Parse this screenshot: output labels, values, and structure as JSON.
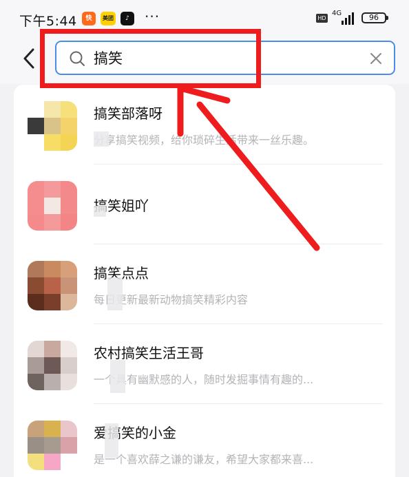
{
  "status_bar": {
    "time": "下午5:44",
    "app_icons": [
      {
        "name": "kuaishou",
        "glyph": "快"
      },
      {
        "name": "meituan",
        "glyph": "美团"
      },
      {
        "name": "tiktok",
        "glyph": "♪"
      }
    ],
    "more": "···",
    "hd": "HD",
    "network": "4G",
    "battery": "96"
  },
  "search": {
    "value": "搞笑",
    "placeholder": ""
  },
  "results": [
    {
      "title": "搞笑部落呀",
      "description": "分享搞笑视频，给你琐碎生活带来一丝乐趣。",
      "avatar_colors": [
        "#ffffff",
        "#f5e7a9",
        "#f6e07c",
        "#3a3a3a",
        "#d9c389",
        "#f3d36a",
        "#ffffff",
        "#f7dc66",
        "#f4d455"
      ]
    },
    {
      "title": "搞笑姐吖",
      "description": "",
      "avatar_colors": [
        "#f58d8f",
        "#f59a9c",
        "#f4898b",
        "#f58d8f",
        "#f3e9e2",
        "#f4898b",
        "#f58a8c",
        "#f49a9b",
        "#f38587"
      ]
    },
    {
      "title": "搞笑点点",
      "description": "每日更新最新动物搞笑精彩内容",
      "avatar_colors": [
        "#b07a5a",
        "#c98a5f",
        "#d7a07a",
        "#8a4b33",
        "#b8624a",
        "#c99378",
        "#5c2d1c",
        "#7a3f2b",
        "#dcb79c"
      ]
    },
    {
      "title": "农村搞笑生活王哥",
      "description": "一个具有幽默感的人，随时发掘事情有趣的...",
      "avatar_colors": [
        "#e2d7d2",
        "#c9a8a0",
        "#f0e9e6",
        "#a99c98",
        "#6d5a56",
        "#d8cfcc",
        "#6f6360",
        "#b9afac",
        "#e7e0dd"
      ]
    },
    {
      "title": "爱搞笑的小金",
      "description": "是一个喜欢薛之谦的谦友，希望大家都来喜...",
      "avatar_colors": [
        "#c7a27a",
        "#d7b24e",
        "#e8c6c9",
        "#9a8f86",
        "#a79a8f",
        "#d9a2a8",
        "#f3df7e",
        "#f6a7c6",
        "#ffffff"
      ]
    }
  ],
  "colors": {
    "accent": "#4a8de8",
    "annotation": "#ee1c1c"
  },
  "icons": {
    "back": "back-arrow-icon",
    "search": "search-icon",
    "clear": "close-icon"
  }
}
